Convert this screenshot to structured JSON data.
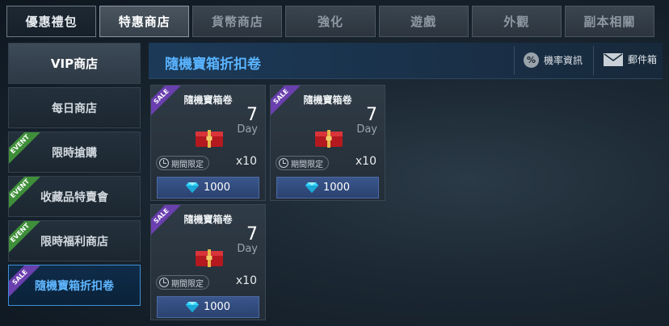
{
  "tabs": [
    "優惠禮包",
    "特惠商店",
    "貨幣商店",
    "強化",
    "遊戲",
    "外觀",
    "副本相關"
  ],
  "sidebar": {
    "items": [
      {
        "label": "VIP商店",
        "badge": ""
      },
      {
        "label": "每日商店",
        "badge": ""
      },
      {
        "label": "限時搶購",
        "badge": "EVENT"
      },
      {
        "label": "收藏品特賣會",
        "badge": "EVENT"
      },
      {
        "label": "限時福利商店",
        "badge": "EVENT"
      },
      {
        "label": "隨機寶箱折扣卷",
        "badge": "SALE"
      }
    ]
  },
  "header": {
    "title": "隨機寶箱折扣卷",
    "rate_info_label": "機率資訊",
    "mailbox_label": "郵件箱",
    "rate_icon_glyph": "%"
  },
  "products": [
    {
      "badge": "SALE",
      "name": "隨機寶箱卷",
      "days": "7",
      "days_unit": "Day",
      "limit_label": "期間限定",
      "quantity": "x10",
      "price": "1000"
    },
    {
      "badge": "SALE",
      "name": "隨機寶箱卷",
      "days": "7",
      "days_unit": "Day",
      "limit_label": "期間限定",
      "quantity": "x10",
      "price": "1000"
    },
    {
      "badge": "SALE",
      "name": "隨機寶箱卷",
      "days": "7",
      "days_unit": "Day",
      "limit_label": "期間限定",
      "quantity": "x10",
      "price": "1000"
    }
  ],
  "colors": {
    "accent_blue": "#59b3ff",
    "event_badge": "#3f8f3a",
    "sale_badge": "#6a3fae",
    "diamond": "#35d6ff"
  },
  "icons": {
    "rate": "percent-icon",
    "mail": "envelope-icon",
    "clock": "clock-icon",
    "currency": "diamond-icon",
    "product": "red-chest-icon"
  }
}
